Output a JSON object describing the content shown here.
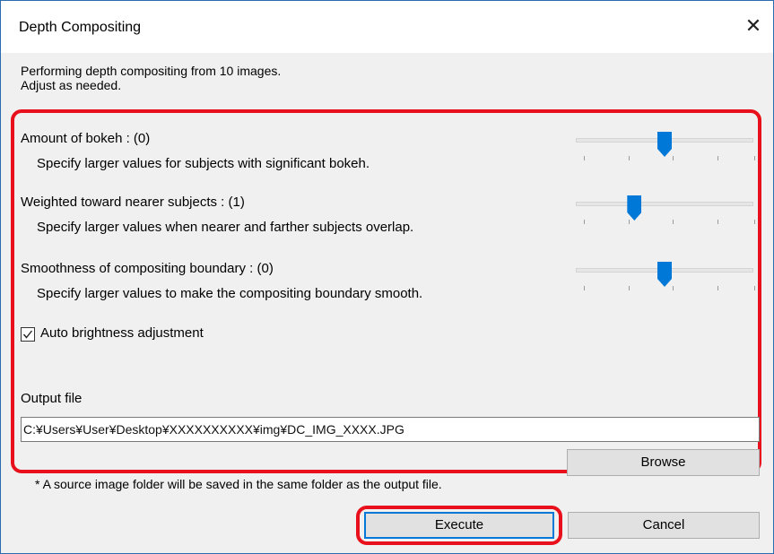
{
  "window": {
    "title": "Depth Compositing",
    "close_glyph": "✕"
  },
  "intro": {
    "line1": "Performing depth compositing from 10 images.",
    "line2": "Adjust as needed."
  },
  "settings": [
    {
      "label": "Amount of bokeh : (0)",
      "description": "Specify larger values for subjects with significant bokeh.",
      "slider_position": 0.5
    },
    {
      "label": "Weighted toward nearer subjects : (1)",
      "description": "Specify larger values when nearer and farther subjects overlap.",
      "slider_position": 0.33
    },
    {
      "label": "Smoothness of compositing boundary : (0)",
      "description": "Specify larger values to make the compositing boundary smooth.",
      "slider_position": 0.5
    }
  ],
  "auto_brightness": {
    "label": "Auto brightness adjustment",
    "checked": true
  },
  "output": {
    "label": "Output file",
    "path": "C:¥Users¥User¥Desktop¥XXXXXXXXXX¥img¥DC_IMG_XXXX.JPG",
    "browse_label": "Browse"
  },
  "note": "* A source image folder will be saved in the same folder as the output file.",
  "buttons": {
    "execute": "Execute",
    "cancel": "Cancel"
  },
  "colors": {
    "highlight": "#e8101c",
    "accent": "#0078d7"
  }
}
